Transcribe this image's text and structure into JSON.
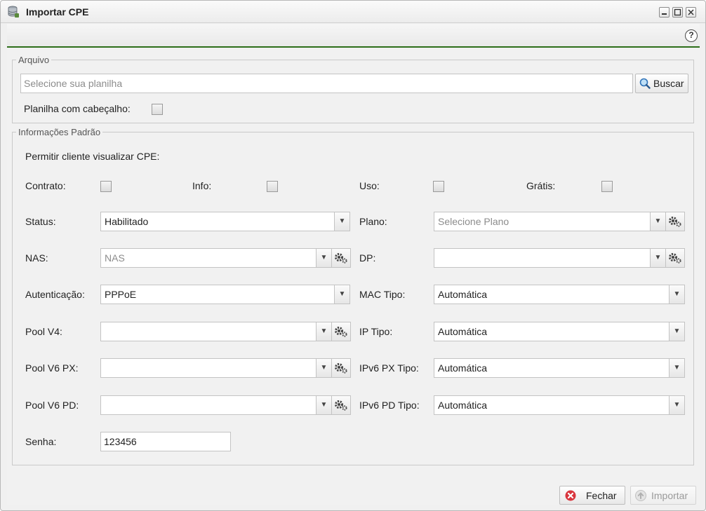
{
  "window": {
    "title": "Importar CPE",
    "icon": "database-import-icon",
    "controls": [
      "minimize",
      "maximize",
      "close"
    ]
  },
  "toolbar": {
    "help_icon": "question-circle-icon"
  },
  "arquivo": {
    "legend": "Arquivo",
    "file_placeholder": "Selecione sua planilha",
    "buscar_label": "Buscar",
    "header_label": "Planilha com cabeçalho:"
  },
  "info": {
    "legend": "Informações Padrão",
    "permitir_label": "Permitir cliente visualizar CPE:",
    "contrato_label": "Contrato:",
    "info_label": "Info:",
    "uso_label": "Uso:",
    "gratis_label": "Grátis:",
    "status_label": "Status:",
    "status_value": "Habilitado",
    "plano_label": "Plano:",
    "plano_placeholder": "Selecione Plano",
    "nas_label": "NAS:",
    "nas_placeholder": "NAS",
    "dp_label": "DP:",
    "dp_value": "",
    "auth_label": "Autenticação:",
    "auth_value": "PPPoE",
    "mac_tipo_label": "MAC Tipo:",
    "mac_tipo_value": "Automática",
    "pool_v4_label": "Pool V4:",
    "pool_v4_value": "",
    "ip_tipo_label": "IP Tipo:",
    "ip_tipo_value": "Automática",
    "pool_v6_px_label": "Pool V6 PX:",
    "pool_v6_px_value": "",
    "ipv6_px_tipo_label": "IPv6 PX Tipo:",
    "ipv6_px_tipo_value": "Automática",
    "pool_v6_pd_label": "Pool V6 PD:",
    "pool_v6_pd_value": "",
    "ipv6_pd_tipo_label": "IPv6 PD Tipo:",
    "ipv6_pd_tipo_value": "Automática",
    "senha_label": "Senha:",
    "senha_value": "123456"
  },
  "footer": {
    "fechar_label": "Fechar",
    "importar_label": "Importar"
  }
}
